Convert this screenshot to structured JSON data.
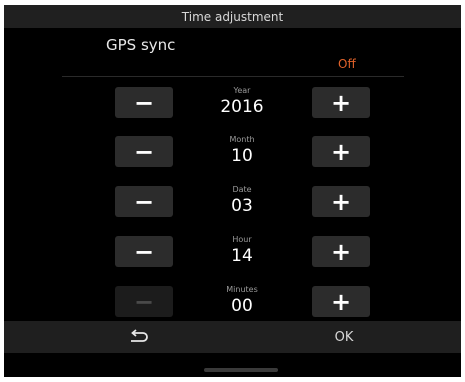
{
  "title": "Time adjustment",
  "gps": {
    "label": "GPS sync",
    "state": "Off",
    "state_color": "#e0622a"
  },
  "buttons": {
    "minus": "−",
    "plus": "+"
  },
  "fields": [
    {
      "label": "Year",
      "value": "2016",
      "minus_enabled": true
    },
    {
      "label": "Month",
      "value": "10",
      "minus_enabled": true
    },
    {
      "label": "Date",
      "value": "03",
      "minus_enabled": true
    },
    {
      "label": "Hour",
      "value": "14",
      "minus_enabled": true
    },
    {
      "label": "Minutes",
      "value": "00",
      "minus_enabled": false
    }
  ],
  "footer": {
    "back_icon": "back-arrow-icon",
    "ok_label": "OK"
  }
}
